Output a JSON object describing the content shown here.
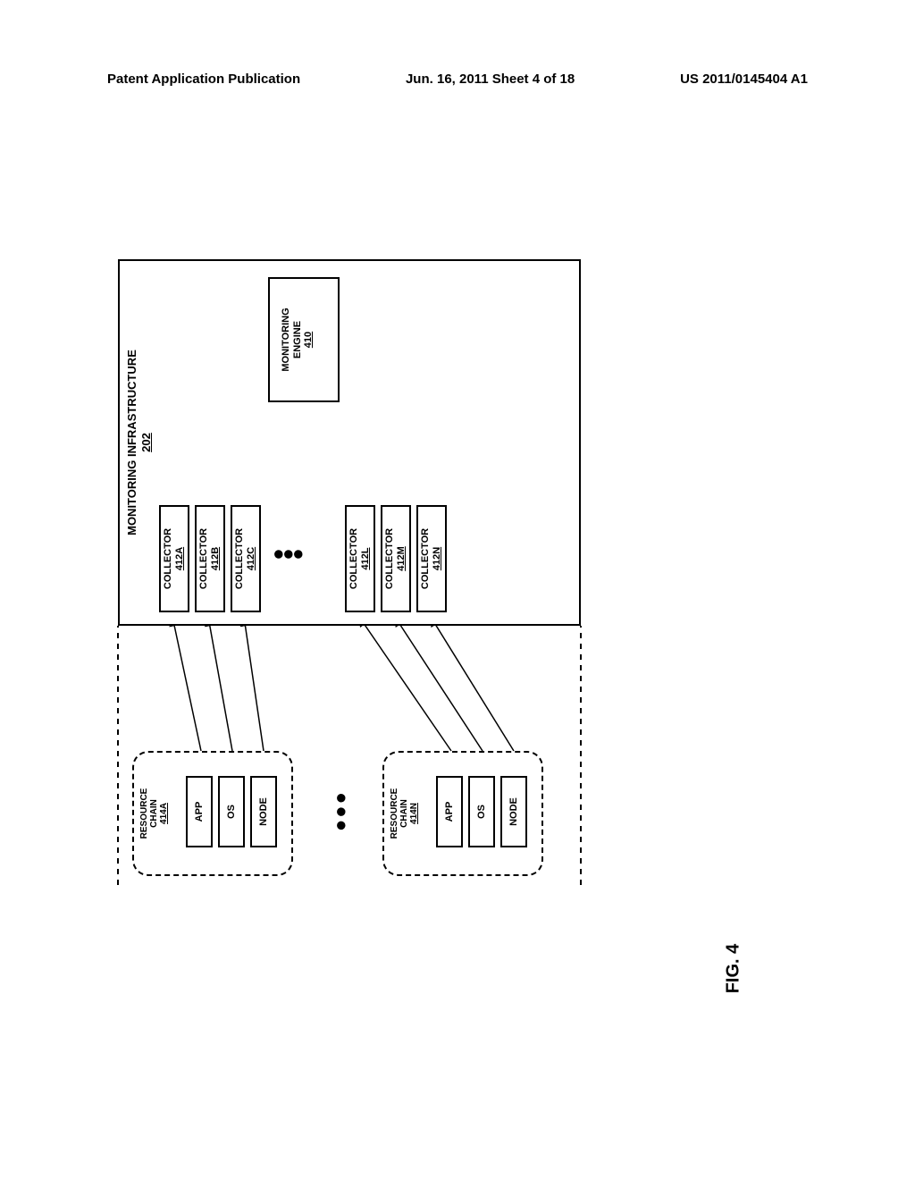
{
  "header": {
    "left": "Patent Application Publication",
    "center": "Jun. 16, 2011  Sheet 4 of 18",
    "right": "US 2011/0145404 A1"
  },
  "diagram": {
    "infra_title": "MONITORING INFRASTRUCTURE",
    "infra_ref": "202",
    "engine_title": "MONITORING",
    "engine_title2": "ENGINE",
    "engine_ref": "410",
    "collectors": [
      {
        "label": "COLLECTOR",
        "ref": "412A"
      },
      {
        "label": "COLLECTOR",
        "ref": "412B"
      },
      {
        "label": "COLLECTOR",
        "ref": "412C"
      },
      {
        "label": "COLLECTOR",
        "ref": "412L"
      },
      {
        "label": "COLLECTOR",
        "ref": "412M"
      },
      {
        "label": "COLLECTOR",
        "ref": "412N"
      }
    ],
    "chainA": {
      "title1": "RESOURCE",
      "title2": "CHAIN",
      "ref": "414A",
      "layers": [
        "APP",
        "OS",
        "NODE"
      ]
    },
    "chainN": {
      "title1": "RESOURCE",
      "title2": "CHAIN",
      "ref": "414N",
      "layers": [
        "APP",
        "OS",
        "NODE"
      ]
    },
    "ellipsis": "●●●"
  },
  "figure_label": "FIG. 4"
}
